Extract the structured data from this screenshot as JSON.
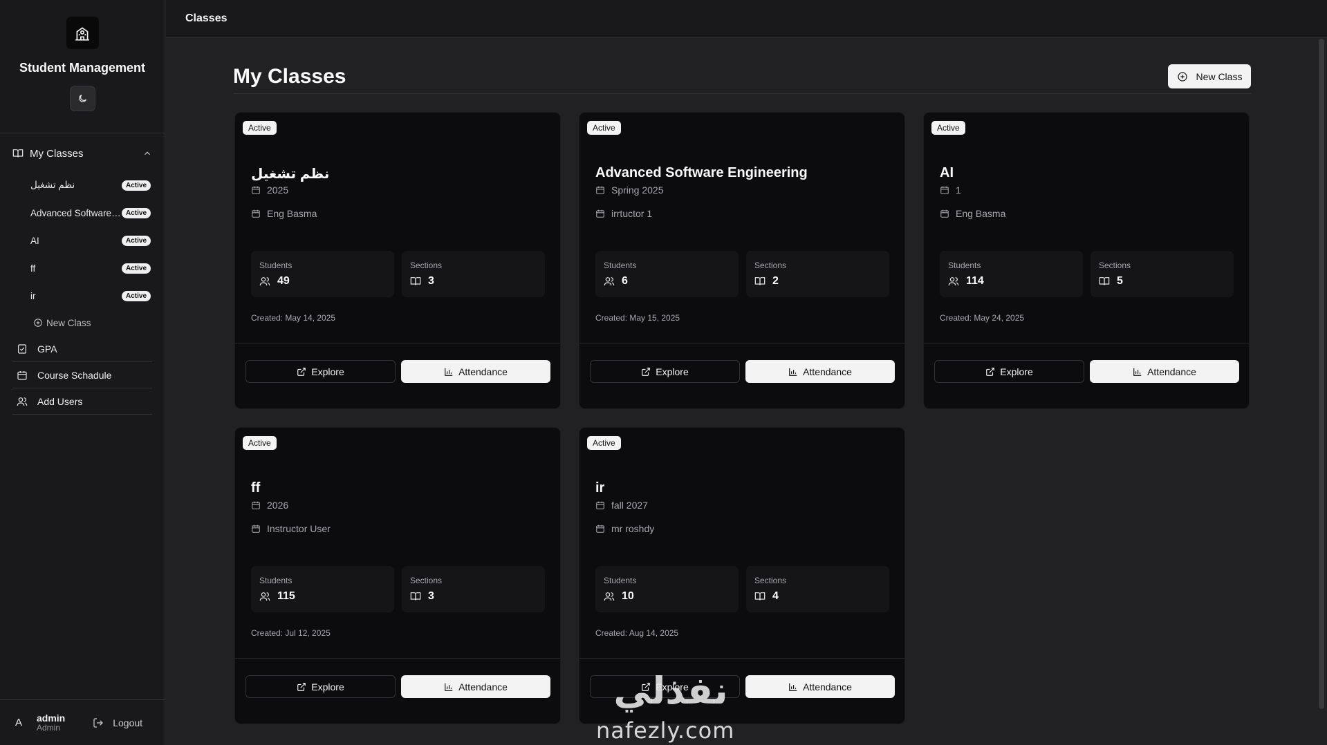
{
  "sidebar": {
    "brand_title": "Student Management",
    "classes_group_label": "My Classes",
    "class_items": [
      {
        "label": "نظم تشغيل",
        "badge": "Active"
      },
      {
        "label": "Advanced Software ...",
        "badge": "Active"
      },
      {
        "label": "AI",
        "badge": "Active"
      },
      {
        "label": "ff",
        "badge": "Active"
      },
      {
        "label": "ir",
        "badge": "Active"
      }
    ],
    "new_class_label": "New Class",
    "nav_items": [
      {
        "label": "GPA",
        "icon": "checklist-icon"
      },
      {
        "label": "Course Schadule",
        "icon": "calendar-icon"
      },
      {
        "label": "Add Users",
        "icon": "users-icon"
      }
    ],
    "user": {
      "avatar": "A",
      "name": "admin",
      "role": "Admin"
    },
    "logout_label": "Logout"
  },
  "topbar": {
    "title": "Classes"
  },
  "main": {
    "page_title": "My Classes",
    "new_class_button": "New Class",
    "stat_students_label": "Students",
    "stat_sections_label": "Sections",
    "explore_label": "Explore",
    "attendance_label": "Attendance",
    "cards": [
      {
        "badge": "Active",
        "name": "نظم تشغيل",
        "term": "2025",
        "instructor": "Eng Basma",
        "students": "49",
        "sections": "3",
        "created": "Created: May 14, 2025"
      },
      {
        "badge": "Active",
        "name": "Advanced Software Engineering",
        "term": "Spring 2025",
        "instructor": "irrtuctor 1",
        "students": "6",
        "sections": "2",
        "created": "Created: May 15, 2025"
      },
      {
        "badge": "Active",
        "name": "AI",
        "term": "1",
        "instructor": "Eng Basma",
        "students": "114",
        "sections": "5",
        "created": "Created: May 24, 2025"
      },
      {
        "badge": "Active",
        "name": "ff",
        "term": "2026",
        "instructor": "Instructor User",
        "students": "115",
        "sections": "3",
        "created": "Created: Jul 12, 2025"
      },
      {
        "badge": "Active",
        "name": "ir",
        "term": "fall 2027",
        "instructor": "mr roshdy",
        "students": "10",
        "sections": "4",
        "created": "Created: Aug 14, 2025"
      }
    ]
  },
  "watermark": {
    "arabic": "نفذلي",
    "latin": "nafezly.com"
  }
}
